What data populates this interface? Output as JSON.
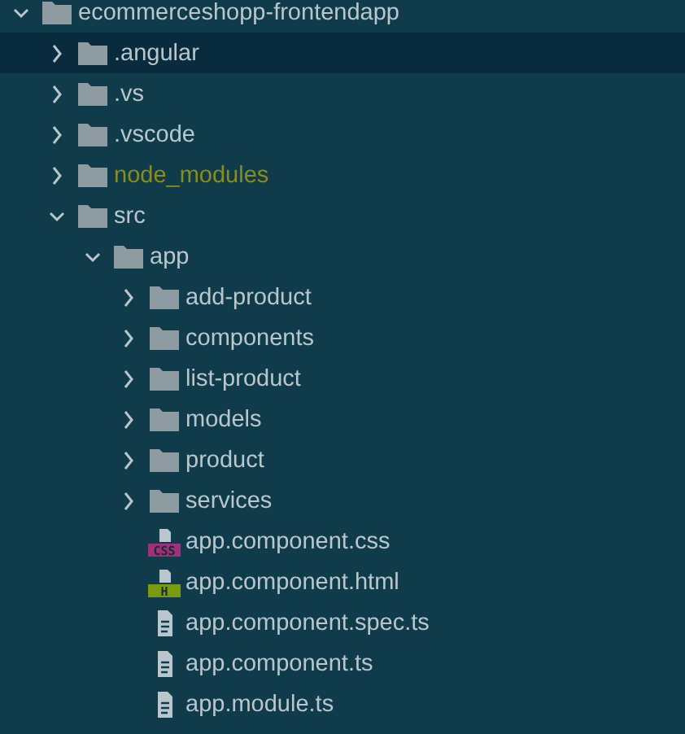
{
  "tree": [
    {
      "kind": "folder",
      "label": "ecommerceshopp-frontendapp",
      "expanded": true,
      "selected": false,
      "ignored": false,
      "children": [
        {
          "kind": "folder",
          "label": ".angular",
          "expanded": false,
          "selected": true,
          "ignored": false
        },
        {
          "kind": "folder",
          "label": ".vs",
          "expanded": false,
          "selected": false,
          "ignored": false
        },
        {
          "kind": "folder",
          "label": ".vscode",
          "expanded": false,
          "selected": false,
          "ignored": false
        },
        {
          "kind": "folder",
          "label": "node_modules",
          "expanded": false,
          "selected": false,
          "ignored": true
        },
        {
          "kind": "folder",
          "label": "src",
          "expanded": true,
          "selected": false,
          "ignored": false,
          "children": [
            {
              "kind": "folder",
              "label": "app",
              "expanded": true,
              "selected": false,
              "ignored": false,
              "children": [
                {
                  "kind": "folder",
                  "label": "add-product",
                  "expanded": false,
                  "selected": false,
                  "ignored": false
                },
                {
                  "kind": "folder",
                  "label": "components",
                  "expanded": false,
                  "selected": false,
                  "ignored": false
                },
                {
                  "kind": "folder",
                  "label": "list-product",
                  "expanded": false,
                  "selected": false,
                  "ignored": false
                },
                {
                  "kind": "folder",
                  "label": "models",
                  "expanded": false,
                  "selected": false,
                  "ignored": false
                },
                {
                  "kind": "folder",
                  "label": "product",
                  "expanded": false,
                  "selected": false,
                  "ignored": false
                },
                {
                  "kind": "folder",
                  "label": "services",
                  "expanded": false,
                  "selected": false,
                  "ignored": false
                },
                {
                  "kind": "css-file",
                  "badge": "CSS",
                  "label": "app.component.css",
                  "selected": false,
                  "ignored": false
                },
                {
                  "kind": "html-file",
                  "badge": "H",
                  "label": "app.component.html",
                  "selected": false,
                  "ignored": false
                },
                {
                  "kind": "file",
                  "label": "app.component.spec.ts",
                  "selected": false,
                  "ignored": false
                },
                {
                  "kind": "file",
                  "label": "app.component.ts",
                  "selected": false,
                  "ignored": false
                },
                {
                  "kind": "file",
                  "label": "app.module.ts",
                  "selected": false,
                  "ignored": false
                }
              ]
            }
          ]
        }
      ]
    }
  ]
}
